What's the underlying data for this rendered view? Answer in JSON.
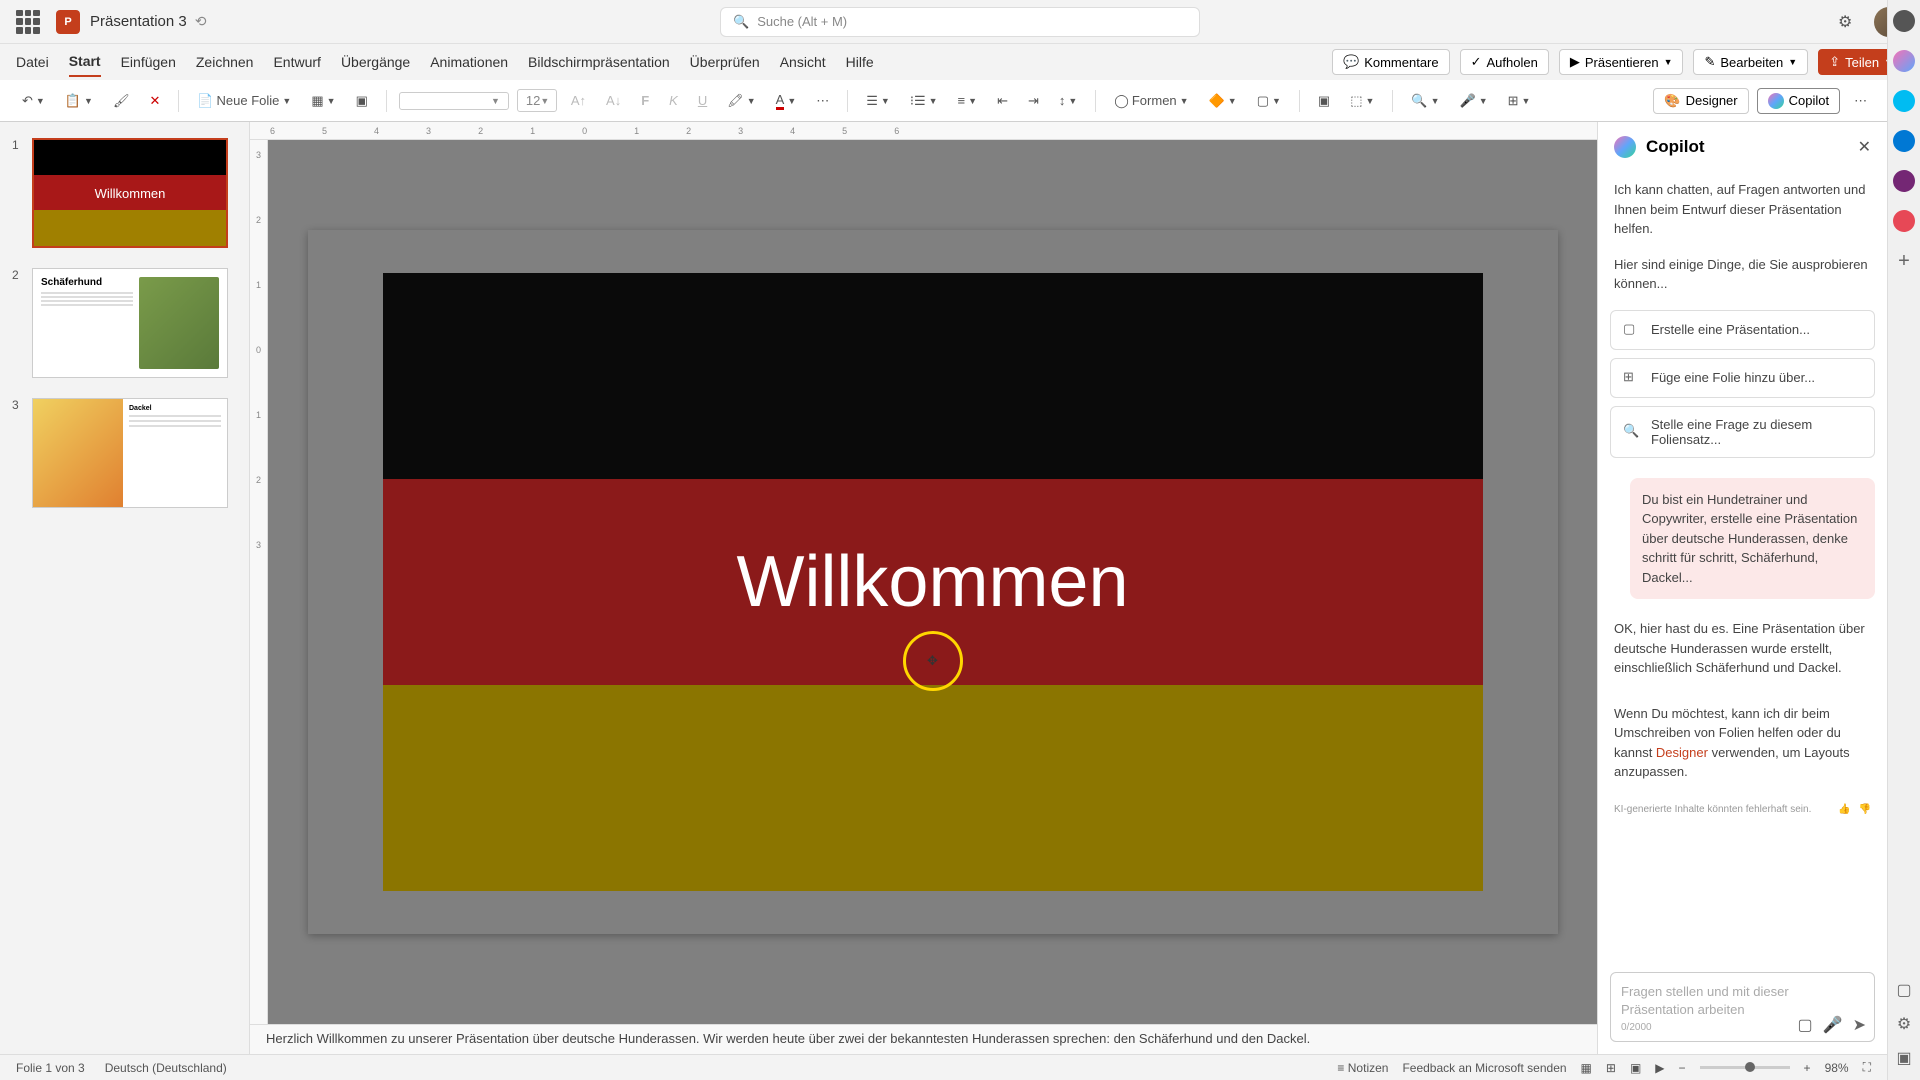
{
  "titlebar": {
    "doc_title": "Präsentation 3",
    "search_placeholder": "Suche (Alt + M)"
  },
  "tabs": {
    "datei": "Datei",
    "start": "Start",
    "einfuegen": "Einfügen",
    "zeichnen": "Zeichnen",
    "entwurf": "Entwurf",
    "uebergaenge": "Übergänge",
    "animationen": "Animationen",
    "bildschirm": "Bildschirmpräsentation",
    "ueberpruefen": "Überprüfen",
    "ansicht": "Ansicht",
    "hilfe": "Hilfe"
  },
  "ribbon_right": {
    "kommentare": "Kommentare",
    "aufholen": "Aufholen",
    "praesentieren": "Präsentieren",
    "bearbeiten": "Bearbeiten",
    "teilen": "Teilen"
  },
  "toolbar": {
    "neue_folie": "Neue Folie",
    "font_size": "12",
    "formen": "Formen",
    "designer": "Designer",
    "copilot": "Copilot"
  },
  "slides": {
    "s1": {
      "num": "1",
      "title": "Willkommen"
    },
    "s2": {
      "num": "2",
      "title": "Schäferhund"
    },
    "s3": {
      "num": "3",
      "title": "Dackel"
    }
  },
  "canvas": {
    "title": "Willkommen",
    "notes": "Herzlich Willkommen zu unserer Präsentation über deutsche Hunderassen. Wir werden heute über zwei der bekanntesten Hunderassen sprechen: den Schäferhund und den Dackel."
  },
  "ruler_h": [
    "6",
    "5",
    "4",
    "3",
    "2",
    "1",
    "0",
    "1",
    "2",
    "3",
    "4",
    "5",
    "6"
  ],
  "ruler_v": [
    "3",
    "2",
    "1",
    "0",
    "1",
    "2",
    "3"
  ],
  "copilot": {
    "title": "Copilot",
    "intro1": "Ich kann chatten, auf Fragen antworten und Ihnen beim Entwurf dieser Präsentation helfen.",
    "intro2": "Hier sind einige Dinge, die Sie ausprobieren können...",
    "suggest1": "Erstelle eine Präsentation...",
    "suggest2": "Füge eine Folie hinzu über...",
    "suggest3": "Stelle eine Frage zu diesem Foliensatz...",
    "user_msg": "Du bist ein Hundetrainer und Copywriter, erstelle eine Präsentation über deutsche Hunderassen, denke schritt für schritt, Schäferhund, Dackel...",
    "ai_msg1": "OK, hier hast du es. Eine Präsentation über deutsche Hunderassen wurde erstellt, einschließlich Schäferhund und Dackel.",
    "ai_msg2_a": "Wenn Du möchtest, kann ich dir beim Umschreiben von Folien helfen oder du kannst ",
    "ai_msg2_link": "Designer",
    "ai_msg2_b": " verwenden, um Layouts anzupassen.",
    "ai_disclaimer": "KI-generierte Inhalte könnten fehlerhaft sein.",
    "input_placeholder": "Fragen stellen und mit dieser Präsentation arbeiten",
    "counter": "0/2000"
  },
  "status": {
    "slide_info": "Folie 1 von 3",
    "language": "Deutsch (Deutschland)",
    "notizen": "Notizen",
    "feedback": "Feedback an Microsoft senden",
    "zoom": "98%"
  }
}
